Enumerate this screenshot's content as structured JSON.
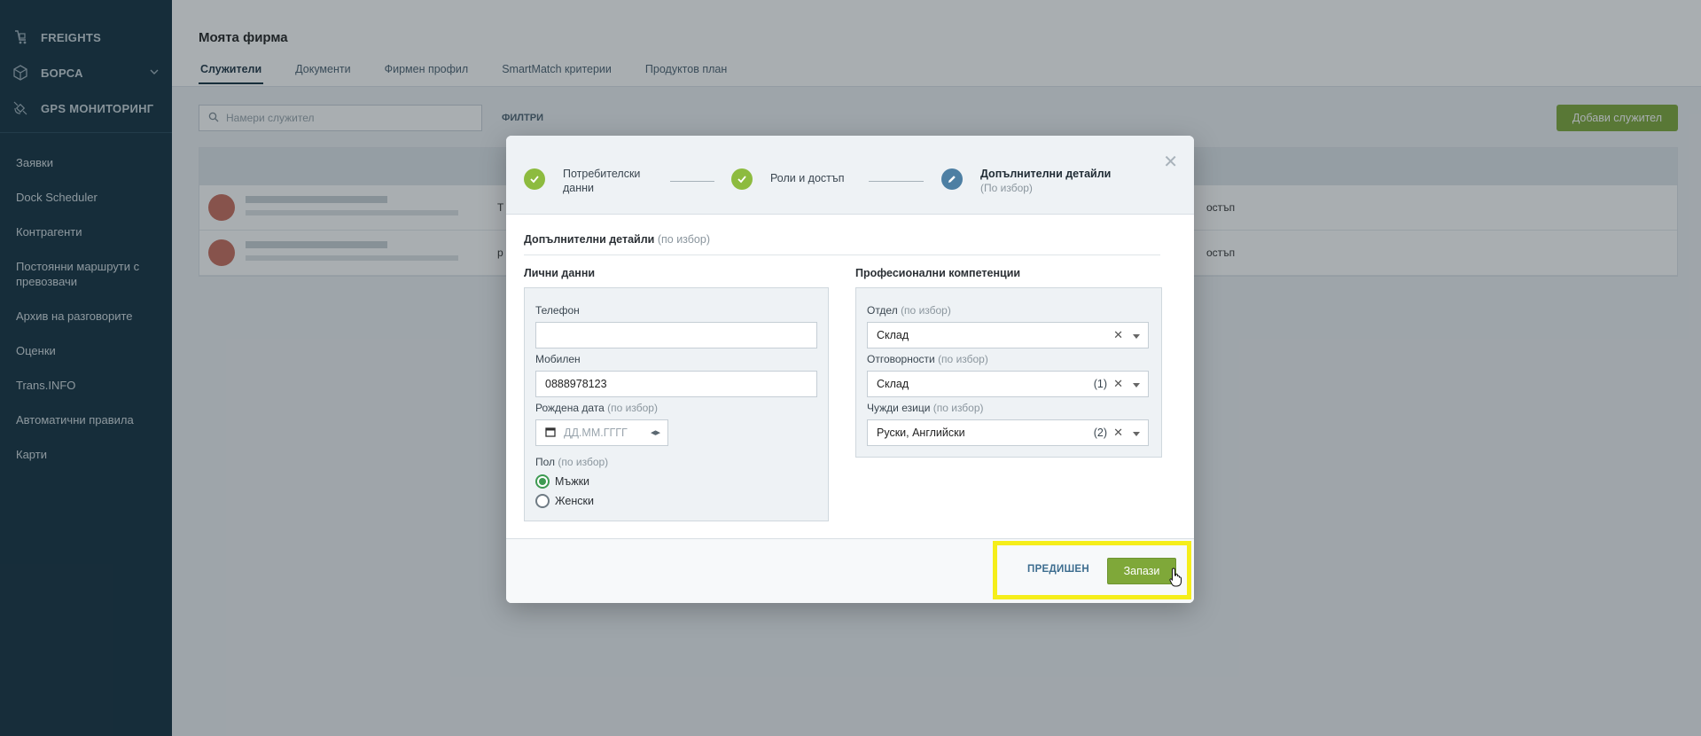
{
  "sidebar": {
    "modules": [
      {
        "label": "FREIGHTS",
        "icon": "freights-icon"
      },
      {
        "label": "БОРСА",
        "icon": "box-icon"
      },
      {
        "label": "GPS МОНИТОРИНГ",
        "icon": "satellite-icon"
      }
    ],
    "links": [
      "Заявки",
      "Dock Scheduler",
      "Контрагенти",
      "Постоянни маршрути с превозвачи",
      "Архив на разговорите",
      "Оценки",
      "Trans.INFO",
      "Автоматични правила",
      "Карти"
    ]
  },
  "main": {
    "title": "Моята фирма",
    "tabs": [
      "Служители",
      "Документи",
      "Фирмен профил",
      "SmartMatch критерии",
      "Продуктов план"
    ],
    "search_placeholder": "Намери служител",
    "filters_label": "ФИЛТРИ",
    "add_button": "Добави служител",
    "rows": [
      {
        "access": "остъп",
        "col": "Т"
      },
      {
        "access": "остъп",
        "col": "р"
      }
    ]
  },
  "modal": {
    "steps": [
      {
        "label": "Потребителски данни",
        "status": "done"
      },
      {
        "label": "Роли и достъп",
        "status": "done"
      },
      {
        "label": "Допълнителни детайли",
        "sub": "(По избор)",
        "status": "current"
      }
    ],
    "section_title": "Допълнителни детайли",
    "section_optional": "(по избор)",
    "personal": {
      "title": "Лични данни",
      "phone_label": "Телефон",
      "phone_value": "",
      "mobile_label": "Мобилен",
      "mobile_value": "0888978123",
      "birth_label": "Рождена дата",
      "birth_optional": "(по избор)",
      "birth_placeholder": "ДД.ММ.ГГГГ",
      "gender_label": "Пол",
      "gender_optional": "(по избор)",
      "gender_options": [
        "Мъжки",
        "Женски"
      ],
      "gender_selected": "Мъжки"
    },
    "professional": {
      "title": "Професионални компетенции",
      "department_label": "Отдел",
      "department_optional": "(по избор)",
      "department_value": "Склад",
      "responsibilities_label": "Отговорности",
      "responsibilities_optional": "(по избор)",
      "responsibilities_value": "Склад",
      "responsibilities_count": "(1)",
      "languages_label": "Чужди езици",
      "languages_optional": "(по избор)",
      "languages_value": "Руски, Английски",
      "languages_count": "(2)"
    },
    "footer": {
      "prev_label": "ПРЕДИШЕН",
      "save_label": "Запази"
    }
  },
  "colors": {
    "sidebar_bg": "#13303f",
    "accent_green": "#7fa839",
    "step_done": "#8dbb3f",
    "step_current": "#4d7fa3",
    "highlight": "#f5ee1a"
  }
}
